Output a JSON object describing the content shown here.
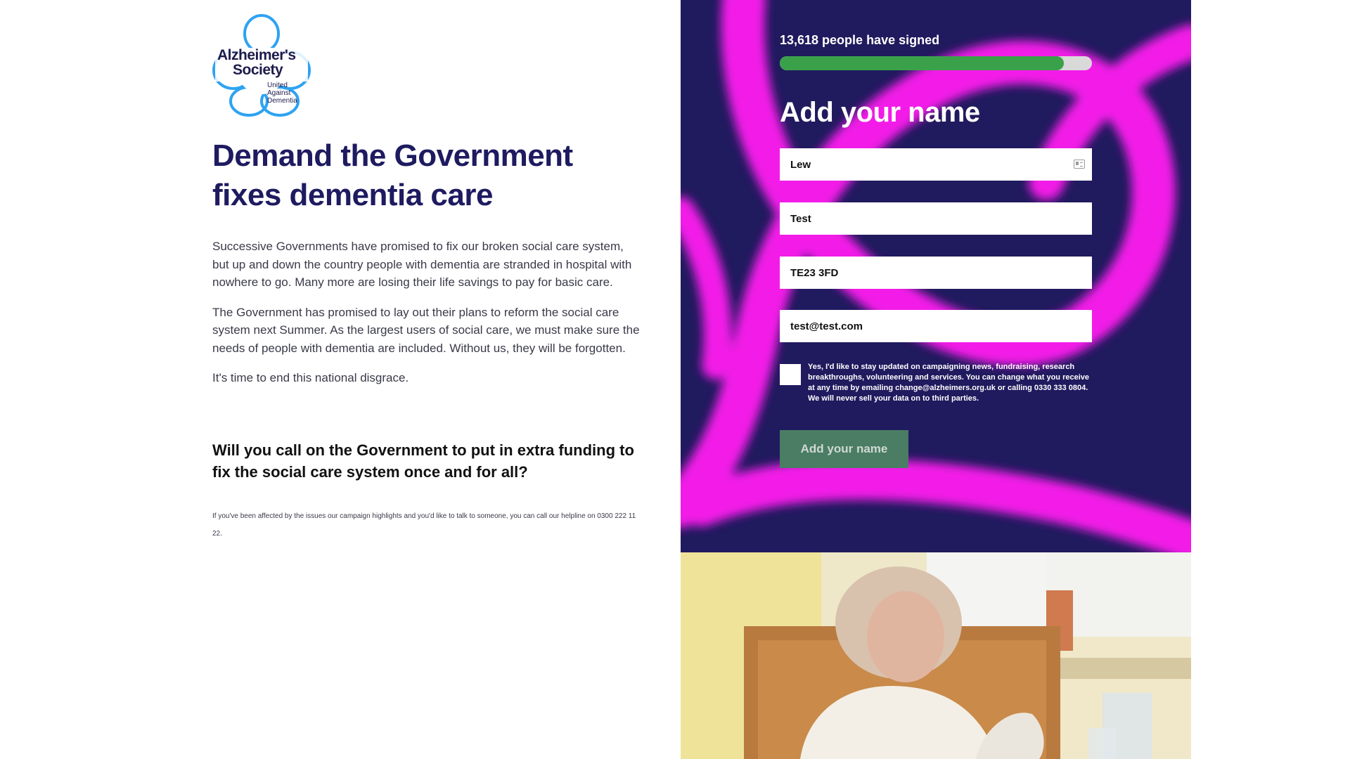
{
  "logo": {
    "line1": "Alzheimer's",
    "line2": "Society",
    "tagline": "United Against Dementia"
  },
  "main": {
    "title": "Demand the Government fixes dementia care",
    "paragraphs": [
      "Successive Governments have promised to fix our broken social care system, but up and down the country people with dementia are stranded in hospital with nowhere to go. Many more are losing their life savings to pay for basic care.",
      "The Government has promised to lay out their plans to reform the social care system next Summer. As the largest users of social care, we must make sure the needs of people with dementia are included. Without us, they will be forgotten.",
      "It's time to end this national disgrace."
    ],
    "question": "Will you call on the Government to put in extra funding to fix the social care system once and for all?",
    "helpline": "If you've been affected by the issues our campaign highlights and you'd like to talk to someone, you can call our helpline on 0300 222 11 22."
  },
  "petition": {
    "signed_text": "13,618 people have signed",
    "progress_fraction": 0.91,
    "progress_color": "#3aa14a",
    "form_title": "Add your name",
    "fields": {
      "first_name": "Lew",
      "last_name": "Test",
      "postcode": "TE23 3FD",
      "email": "test@test.com"
    },
    "consent_text": "Yes, I'd like to stay updated on campaigning news, fundraising, research breakthroughs, volunteering and services. You can change what you receive at any time by emailing change@alzheimers.org.uk or calling 0330 333 0804. We will never sell your data on to third parties.",
    "submit_label": "Add your name"
  },
  "colors": {
    "panel_bg": "#201a5e",
    "accent_magenta": "#ff1cf0",
    "title_navy": "#1e1b60",
    "button_green": "#4a7d63"
  }
}
